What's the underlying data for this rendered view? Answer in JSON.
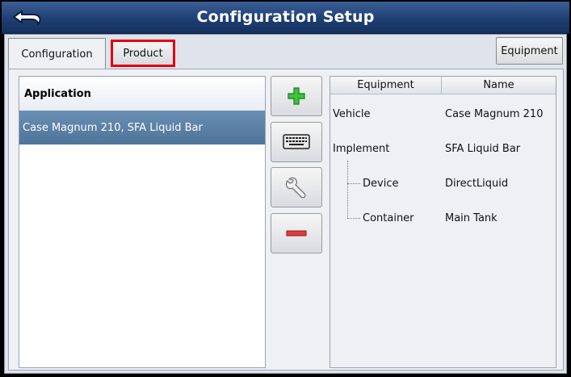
{
  "header": {
    "title": "Configuration Setup",
    "back_icon": "back-arrow-icon"
  },
  "tabs": {
    "configuration": "Configuration",
    "product": "Product",
    "equipment": "Equipment"
  },
  "application_list": {
    "header": "Application",
    "items": [
      "Case Magnum 210, SFA Liquid Bar"
    ]
  },
  "actions": {
    "add_icon": "plus-icon",
    "keyboard_icon": "keyboard-icon",
    "wrench_icon": "wrench-icon",
    "remove_icon": "minus-icon"
  },
  "equipment_table": {
    "columns": [
      "Equipment",
      "Name"
    ],
    "rows": [
      {
        "equipment": "Vehicle",
        "name": "Case Magnum 210"
      },
      {
        "equipment": "Implement",
        "name": "SFA Liquid Bar"
      },
      {
        "equipment": "Device",
        "name": "DirectLiquid"
      },
      {
        "equipment": "Container",
        "name": "Main Tank"
      }
    ]
  },
  "colors": {
    "title_bar": "#1f3f72",
    "selected_row": "#5a80a6",
    "highlight_border": "#e3000f",
    "add_green": "#2fb52f",
    "remove_red": "#d8242a"
  }
}
